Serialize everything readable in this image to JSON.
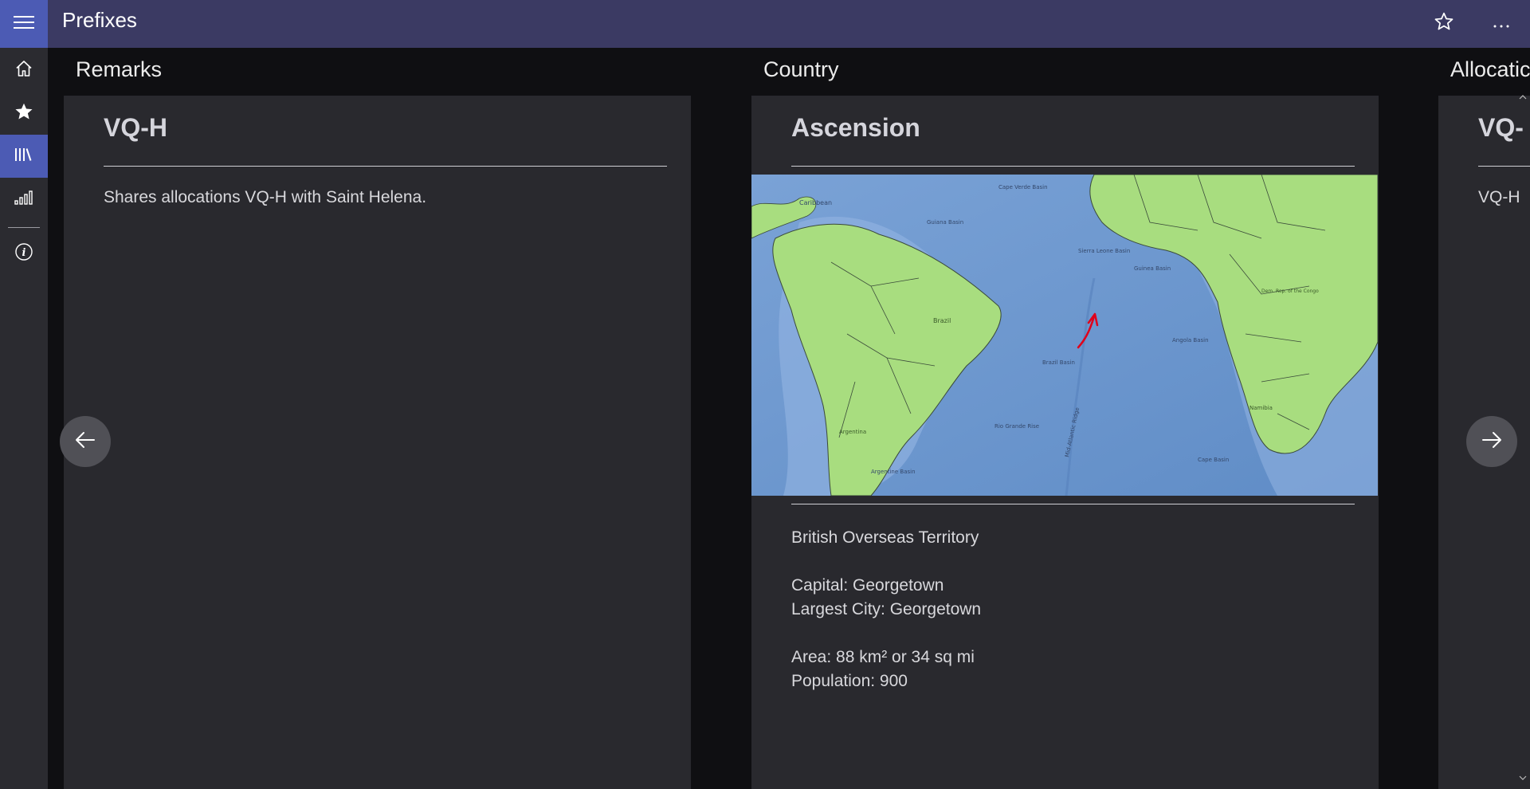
{
  "app": {
    "title": "Prefixes"
  },
  "columns": {
    "remarks": {
      "header": "Remarks",
      "title": "VQ-H",
      "text": "Shares allocations VQ-H with Saint Helena."
    },
    "country": {
      "header": "Country",
      "title": "Ascension",
      "status": "British Overseas Territory",
      "capital": "Capital: Georgetown",
      "largest_city": "Largest City: Georgetown",
      "area": "Area: 88 km² or 34 sq mi",
      "population": "Population: 900"
    },
    "allocation": {
      "header": "Allocatic",
      "title": "VQ-",
      "text": "VQ-H"
    }
  },
  "map_labels": {
    "caribbean": "Caribbean",
    "cape_verde": "Cape Verde Basin",
    "guiana": "Guiana Basin",
    "sierra_leone": "Sierra Leone Basin",
    "guinea": "Guinea Basin",
    "brazil": "Brazil",
    "brazil_basin": "Brazil Basin",
    "angola_basin": "Angola Basin",
    "argentina": "Argentina",
    "argentine_basin": "Argentine Basin",
    "rio_grande": "Rio Grande Rise",
    "mid_atlantic": "Mid-Atlantic Ridge",
    "cape_basin": "Cape Basin",
    "democratic_congo": "Dem. Rep. of the Congo",
    "namibia": "Namibia"
  },
  "colors": {
    "titlebar": "#3b3a63",
    "accent": "#4c5bb4",
    "card": "#29292e",
    "ocean": "#6f98cf",
    "land": "#a8dd7f",
    "marker": "#e0001b"
  }
}
